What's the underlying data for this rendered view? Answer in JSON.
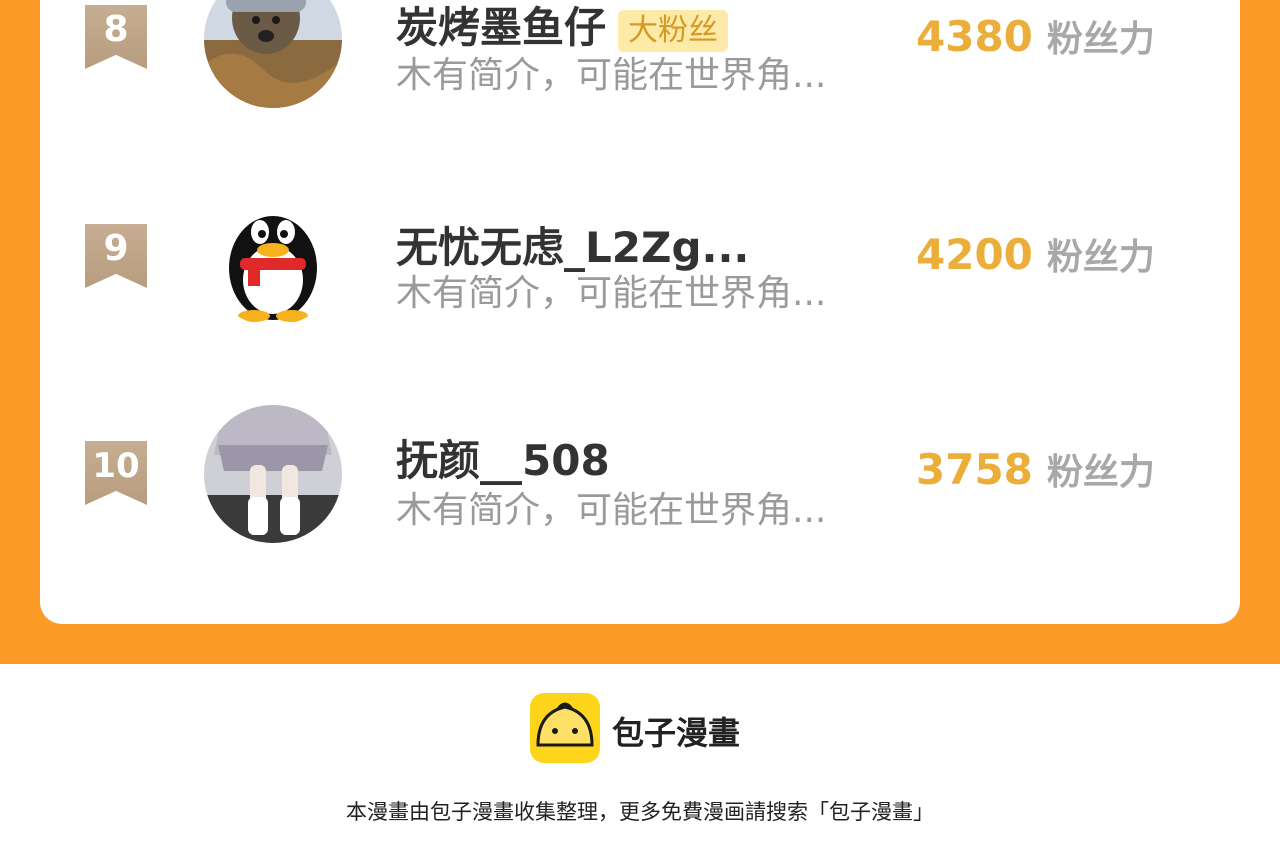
{
  "ranking": {
    "unit_label": "粉丝力",
    "rows": [
      {
        "rank": "8",
        "name": "炭烤墨鱼仔",
        "tag": "大粉丝",
        "bio": "木有简介，可能在世界角...",
        "score": "4380"
      },
      {
        "rank": "9",
        "name": "无忧无虑_L2Zg...",
        "bio": "木有简介，可能在世界角...",
        "score": "4200"
      },
      {
        "rank": "10",
        "name": "抚颜__508",
        "bio": "木有简介，可能在世界角...",
        "score": "3758"
      }
    ]
  },
  "footer": {
    "brand": "包子漫畫",
    "note": "本漫畫由包子漫畫收集整理，更多免費漫画請搜索「包子漫畫」"
  },
  "colors": {
    "background_orange": "#fb9b26",
    "score_gold": "#ecae3a",
    "badge_tan": "#c6ad91",
    "logo_yellow": "#ffd51c"
  }
}
